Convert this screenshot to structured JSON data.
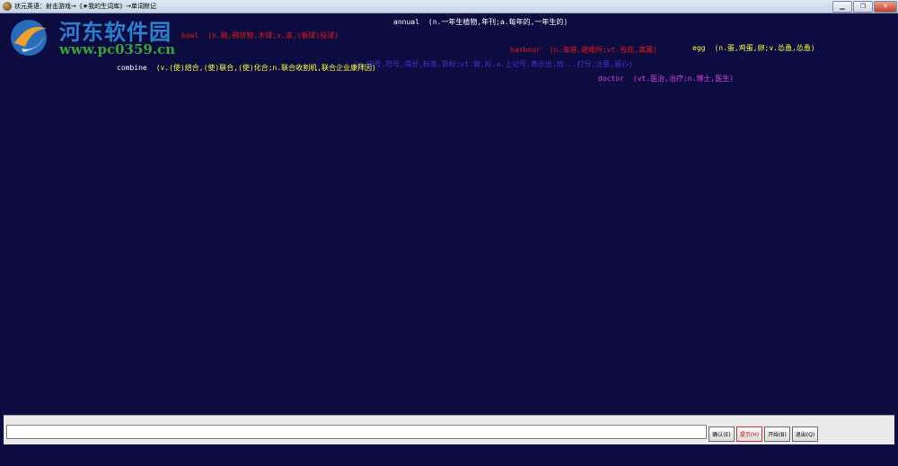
{
  "window": {
    "title": "状元英语：射击游戏→《★我的生词库》→单词默记",
    "minimize_label": "▁",
    "maximize_label": "❐",
    "close_label": "✕"
  },
  "watermark": {
    "title": "河东软件园",
    "url": "www.pc0359.cn"
  },
  "words": [
    {
      "english": "annual",
      "chinese": "(n.一年生植物,年刊;a.每年的,一年生的)",
      "color_en": "#ffffff",
      "color_cn": "#ffffff"
    },
    {
      "english": "bowl",
      "chinese": "(n.碗,碗状物,木球;v.滚,(板球)投球)",
      "color_en": "#e81818",
      "color_cn": "#e81818"
    },
    {
      "english": "harbour",
      "chinese": "(n.海港,避难所;vt.包庇,窝藏)",
      "color_en": "#e81818",
      "color_cn": "#e81818"
    },
    {
      "english": "egg",
      "chinese": "(n.蛋,鸡蛋,卵;v.怂恿,怂恿)",
      "color_en": "#ffff40",
      "color_cn": "#ffff40"
    },
    {
      "english": "",
      "chinese": "(n.记号,符号,得分,标准,目标;vt.做,标,a.上记号,表示出,给...打分,注意,留心)",
      "color_en": "#3a3ad8",
      "color_cn": "#3a3ad8"
    },
    {
      "english": "combine",
      "chinese": "(v.(使)结合,(使)联合,(使)化合;n.联合收割机,联合企业康拜因)",
      "color_en": "#ffffff",
      "color_cn": "#ffff40"
    },
    {
      "english": "doctor",
      "chinese": "(vt.医治,治疗;n.博士,医生)",
      "color_en": "#e040e0",
      "color_cn": "#e040e0"
    }
  ],
  "controls": {
    "input_value": "",
    "confirm_label": "确认(E)",
    "show_label": "提示(H)",
    "start_label": "开始(B)",
    "exit_label": "退出(Q)"
  }
}
